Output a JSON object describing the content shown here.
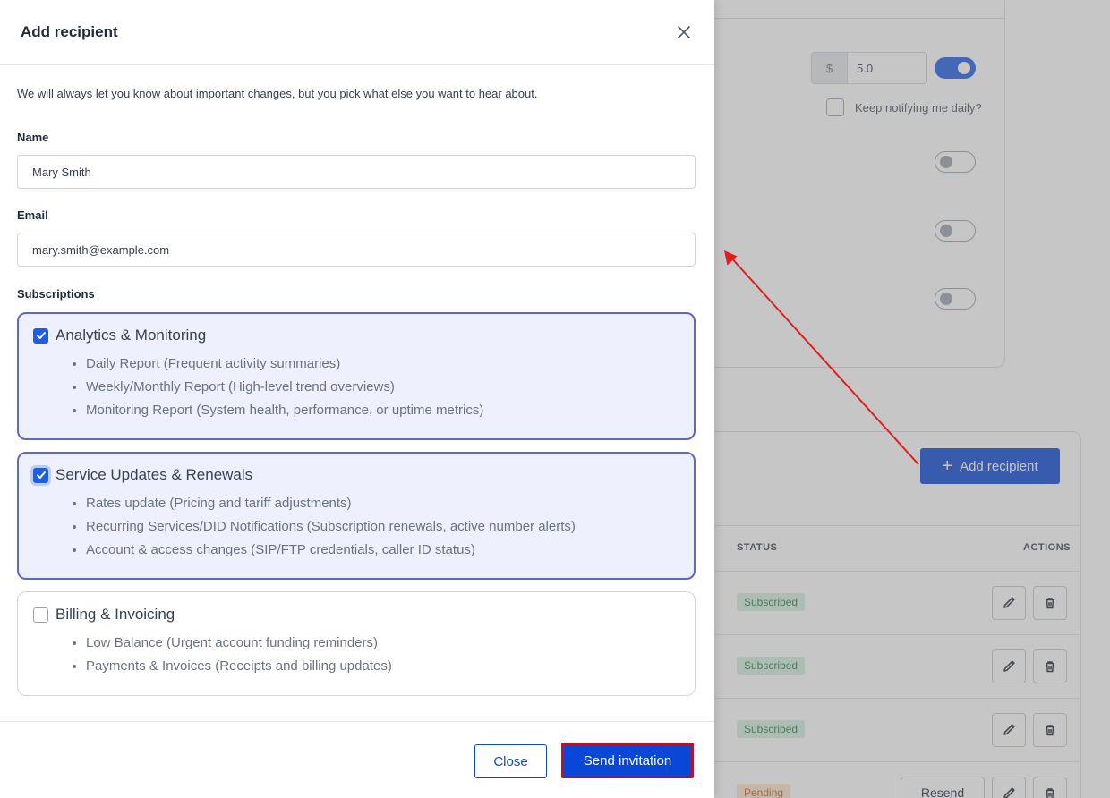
{
  "background": {
    "price": {
      "currency": "$",
      "value": "5.0"
    },
    "keep_notifying_label": "Keep notifying me daily?",
    "add_recipient_label": "Add recipient",
    "table": {
      "status_header": "STATUS",
      "actions_header": "ACTIONS",
      "rows": [
        {
          "status": "Subscribed"
        },
        {
          "status": "Subscribed"
        },
        {
          "status": "Subscribed"
        },
        {
          "status": "Pending",
          "action": "Resend"
        }
      ]
    }
  },
  "modal": {
    "title": "Add recipient",
    "intro": "We will always let you know about important changes, but you pick what else you want to hear about.",
    "name": {
      "label": "Name",
      "value": "Mary Smith"
    },
    "email": {
      "label": "Email",
      "value": "mary.smith@example.com"
    },
    "subscriptions_label": "Subscriptions",
    "subscriptions": [
      {
        "title": "Analytics & Monitoring",
        "checked": true,
        "items": [
          "Daily Report (Frequent activity summaries)",
          "Weekly/Monthly Report (High-level trend overviews)",
          "Monitoring Report (System health, performance, or uptime metrics)"
        ]
      },
      {
        "title": "Service Updates & Renewals",
        "checked": true,
        "items": [
          "Rates update (Pricing and tariff adjustments)",
          "Recurring Services/DID Notifications (Subscription renewals, active number alerts)",
          "Account & access changes (SIP/FTP credentials, caller ID status)"
        ]
      },
      {
        "title": "Billing & Invoicing",
        "checked": false,
        "items": [
          "Low Balance (Urgent account funding reminders)",
          "Payments & Invoices (Receipts and billing updates)"
        ]
      }
    ],
    "buttons": {
      "close": "Close",
      "send": "Send invitation"
    }
  },
  "colors": {
    "primary": "#0b47d6",
    "highlight_border": "#b4152a",
    "annotation_arrow": "#e01e1e"
  }
}
